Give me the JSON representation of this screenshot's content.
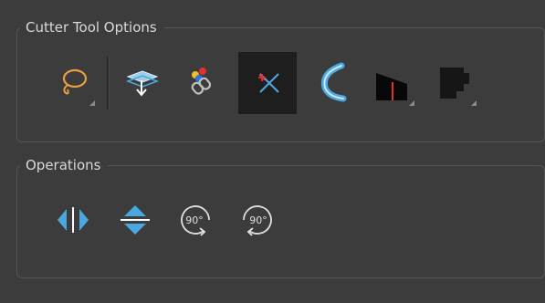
{
  "cutter_tool_options": {
    "title": "Cutter Tool Options",
    "tools": [
      {
        "name": "Lasso"
      },
      {
        "name": "Apply to Layers Below"
      },
      {
        "name": "Use Mouse Gesture / Group"
      },
      {
        "name": "Cutter Mode",
        "selected": true
      },
      {
        "name": "Smooth"
      },
      {
        "name": "Auto Fill"
      },
      {
        "name": "Shape"
      }
    ]
  },
  "operations": {
    "title": "Operations",
    "items": [
      {
        "name": "Flip Horizontal"
      },
      {
        "name": "Flip Vertical"
      },
      {
        "name": "Rotate 90 CW",
        "label": "90°"
      },
      {
        "name": "Rotate 90 CCW",
        "label": "90°"
      }
    ]
  },
  "colors": {
    "accent": "#4aa8e0",
    "lasso": "#e8a040",
    "selected_bg": "#1e1e1e",
    "panel_bg": "#3c3c3c"
  }
}
